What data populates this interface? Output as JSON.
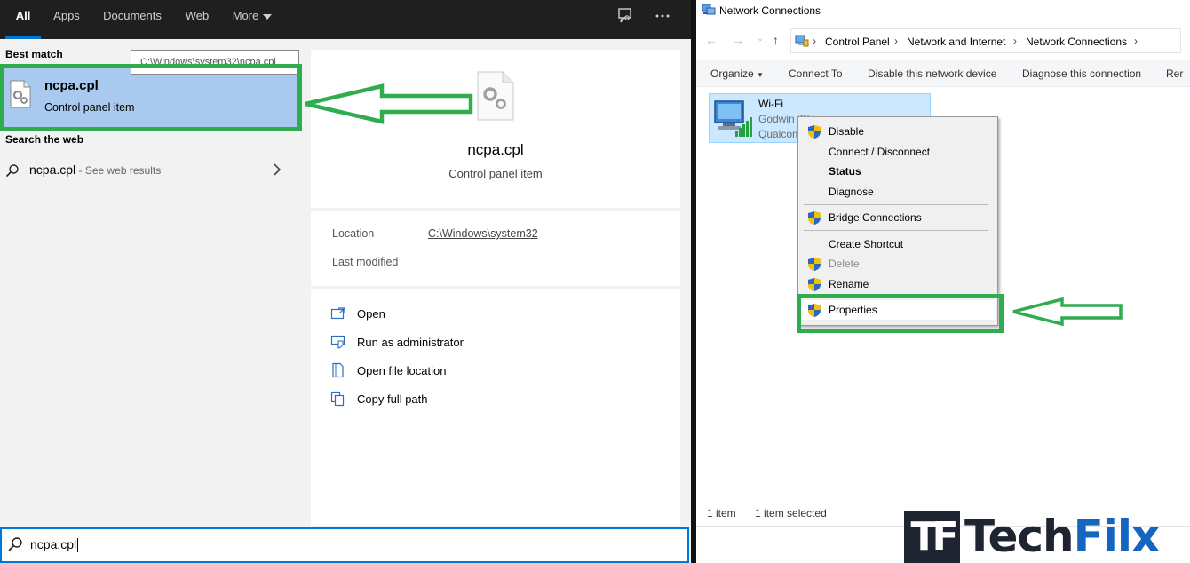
{
  "colors": {
    "accent": "#0078d7",
    "selection": "#a9c9ef",
    "annotation_green": "#2eac4e",
    "logo_dark": "#1e2430",
    "logo_blue": "#1565c0"
  },
  "search": {
    "tabs": [
      {
        "label": "All",
        "active": true
      },
      {
        "label": "Apps"
      },
      {
        "label": "Documents"
      },
      {
        "label": "Web"
      },
      {
        "label": "More"
      }
    ],
    "icons": [
      "feedback-icon",
      "more-options-icon"
    ],
    "best_match_heading": "Best match",
    "best_match": {
      "title": "ncpa.cpl",
      "subtitle": "Control panel item",
      "icon": "control-panel-file-icon"
    },
    "tooltip": "C:\\Windows\\system32\\ncpa.cpl",
    "search_web_heading": "Search the web",
    "web_result": {
      "query": "ncpa.cpl",
      "suffix": " - See web results"
    },
    "preview": {
      "title": "ncpa.cpl",
      "subtitle": "Control panel item",
      "location_label": "Location",
      "location_value": "C:\\Windows\\system32",
      "modified_label": "Last modified"
    },
    "actions": [
      {
        "label": "Open",
        "icon": "open-icon"
      },
      {
        "label": "Run as administrator",
        "icon": "run-as-admin-icon"
      },
      {
        "label": "Open file location",
        "icon": "file-location-icon"
      },
      {
        "label": "Copy full path",
        "icon": "copy-path-icon"
      }
    ],
    "query": "ncpa.cpl"
  },
  "network": {
    "title": "Network Connections",
    "breadcrumbs": [
      "Control Panel",
      "Network and Internet",
      "Network Connections"
    ],
    "commands": [
      "Organize",
      "Connect To",
      "Disable this network device",
      "Diagnose this connection",
      "Rer"
    ],
    "adapter": {
      "name": "Wi-Fi",
      "line2": "Godwin iPhone",
      "line3": "Qualcom"
    },
    "menu": [
      {
        "label": "Disable",
        "shield": true
      },
      {
        "label": "Connect / Disconnect"
      },
      {
        "label": "Status",
        "bold": true
      },
      {
        "label": "Diagnose"
      },
      {
        "label": "Bridge Connections",
        "shield": true
      },
      {
        "label": "Create Shortcut"
      },
      {
        "label": "Delete",
        "shield": true,
        "disabled": true
      },
      {
        "label": "Rename",
        "shield": true
      },
      {
        "label": "Properties",
        "shield": true
      }
    ],
    "status": {
      "count": "1 item",
      "selected": "1 item selected"
    }
  },
  "logo": {
    "mark": "TF",
    "text_a": "Tech",
    "text_b": "Filx"
  }
}
